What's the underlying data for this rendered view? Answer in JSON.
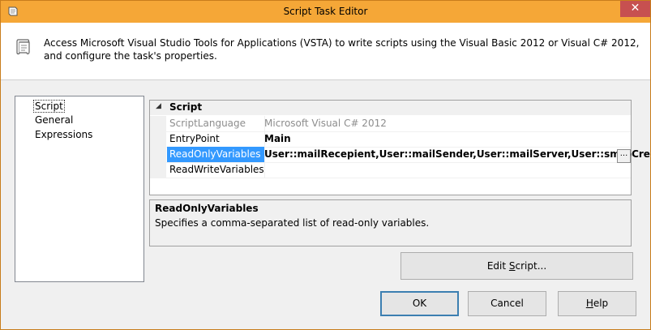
{
  "window": {
    "title": "Script Task Editor",
    "close_glyph": "✕"
  },
  "header": {
    "description": "Access Microsoft Visual Studio Tools for Applications (VSTA) to write scripts using the Visual Basic 2012 or Visual C# 2012, and configure the task's properties."
  },
  "nav": {
    "items": [
      {
        "label": "Script",
        "selected": true
      },
      {
        "label": "General",
        "selected": false
      },
      {
        "label": "Expressions",
        "selected": false
      }
    ]
  },
  "grid": {
    "category": "Script",
    "collapse_glyph": "◢",
    "rows": [
      {
        "name": "ScriptLanguage",
        "value": "Microsoft Visual C# 2012"
      },
      {
        "name": "EntryPoint",
        "value": "Main"
      },
      {
        "name": "ReadOnlyVariables",
        "value": "User::mailRecepient,User::mailSender,User::mailServer,User::smtpCredential"
      },
      {
        "name": "ReadWriteVariables",
        "value": ""
      }
    ],
    "ellipsis_label": "..."
  },
  "description": {
    "title": "ReadOnlyVariables",
    "body": "Specifies a comma-separated list of read-only variables."
  },
  "buttons": {
    "edit_script_pre": "Edit ",
    "edit_script_ul": "S",
    "edit_script_post": "cript...",
    "ok": "OK",
    "cancel": "Cancel",
    "help_ul": "H",
    "help_post": "elp"
  },
  "colors": {
    "titlebar": "#f5a737",
    "selection": "#3399ff",
    "close": "#c75050"
  }
}
